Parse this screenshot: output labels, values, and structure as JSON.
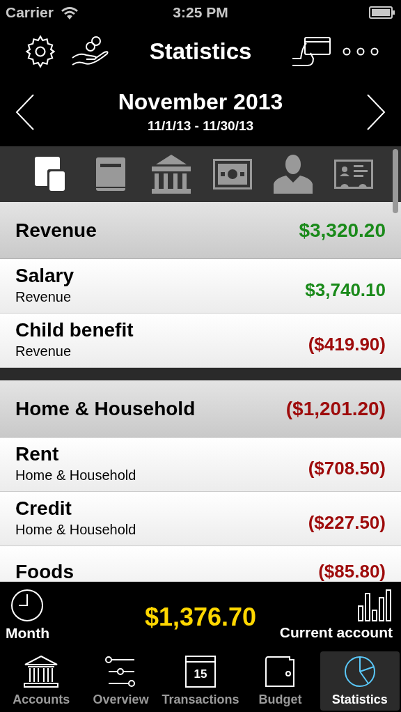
{
  "status_bar": {
    "carrier": "Carrier",
    "time": "3:25 PM"
  },
  "header": {
    "title": "Statistics",
    "period": "November 2013",
    "range": "11/1/13 - 11/30/13"
  },
  "category_filters": [
    {
      "kind": "devices",
      "selected": true
    },
    {
      "kind": "book",
      "selected": false
    },
    {
      "kind": "bank",
      "selected": false
    },
    {
      "kind": "cash",
      "selected": false
    },
    {
      "kind": "person",
      "selected": false
    },
    {
      "kind": "card",
      "selected": false
    }
  ],
  "groups": [
    {
      "name": "Revenue",
      "total": "$3,320.20",
      "negative": false,
      "items": [
        {
          "name": "Salary",
          "category": "Revenue",
          "amount": "$3,740.10",
          "negative": false
        },
        {
          "name": "Child benefit",
          "category": "Revenue",
          "amount": "($419.90)",
          "negative": true
        }
      ]
    },
    {
      "name": "Home & Household",
      "total": "($1,201.20)",
      "negative": true,
      "items": [
        {
          "name": "Rent",
          "category": "Home & Household",
          "amount": "($708.50)",
          "negative": true
        },
        {
          "name": "Credit",
          "category": "Home & Household",
          "amount": "($227.50)",
          "negative": true
        },
        {
          "name": "Foods",
          "amount": "($85.80)",
          "negative": true
        }
      ]
    }
  ],
  "summary": {
    "period_label": "Month",
    "balance": "$1,376.70",
    "account_label": "Current account"
  },
  "tabs": [
    {
      "label": "Accounts",
      "kind": "bank",
      "selected": false
    },
    {
      "label": "Overview",
      "kind": "sliders",
      "selected": false
    },
    {
      "label": "Transactions",
      "kind": "calendar",
      "selected": false,
      "day": "15"
    },
    {
      "label": "Budget",
      "kind": "wallet",
      "selected": false
    },
    {
      "label": "Statistics",
      "kind": "pie",
      "selected": true
    }
  ]
}
